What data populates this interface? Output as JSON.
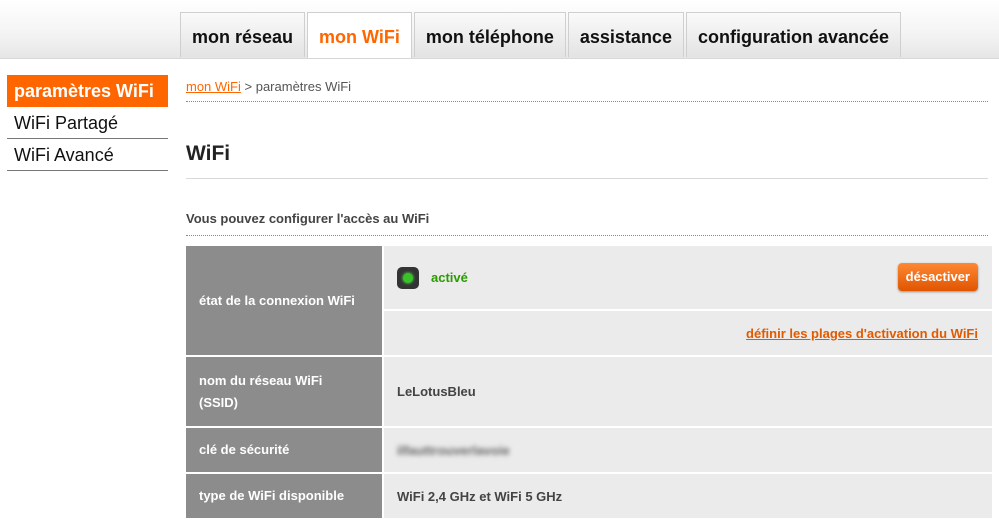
{
  "nav": {
    "tabs": [
      {
        "label": "mon réseau"
      },
      {
        "label": "mon WiFi"
      },
      {
        "label": "mon téléphone"
      },
      {
        "label": "assistance"
      },
      {
        "label": "configuration avancée"
      }
    ],
    "active_tab": "mon WiFi"
  },
  "sidebar": {
    "items": [
      {
        "label": "paramètres WiFi"
      },
      {
        "label": "WiFi Partagé"
      },
      {
        "label": "WiFi Avancé"
      }
    ],
    "active_item": "paramètres WiFi"
  },
  "breadcrumb": {
    "link": "mon WiFi",
    "separator": " > ",
    "current": "paramètres WiFi"
  },
  "page": {
    "title": "WiFi",
    "section_title": "Vous pouvez configurer l'accès au WiFi"
  },
  "settings": {
    "connection": {
      "label": "état de la connexion WiFi",
      "status": "activé",
      "button": "désactiver",
      "link": "définir les plages d'activation du WiFi"
    },
    "ssid": {
      "label": "nom du réseau WiFi (SSID)",
      "value": "LeLotusBleu"
    },
    "key": {
      "label": "clé de sécurité",
      "value": "ilfauttrouverlavoie"
    },
    "wifi_type": {
      "label": "type de WiFi disponible",
      "value": "WiFi 2,4 GHz et WiFi 5 GHz"
    }
  },
  "colors": {
    "accent": "#ff6600",
    "status_green": "#2a9b00",
    "label_bg": "#8c8c8c",
    "value_bg": "#ebebeb"
  },
  "icons": {
    "status": "status-led-green-icon"
  }
}
